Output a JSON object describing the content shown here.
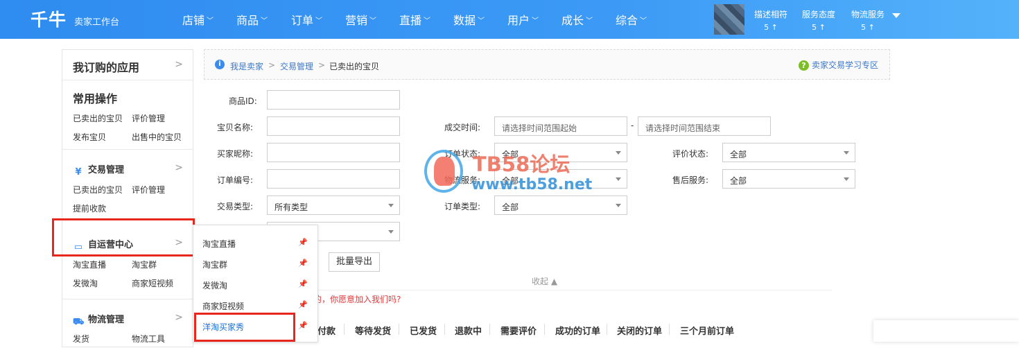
{
  "header": {
    "logo": "千牛",
    "logo_sub": "卖家工作台",
    "nav": [
      "店铺",
      "商品",
      "订单",
      "营销",
      "直播",
      "数据",
      "用户",
      "成长",
      "综合"
    ],
    "scores": [
      {
        "label": "描述相符",
        "value": "5 ↑"
      },
      {
        "label": "服务态度",
        "value": "5 ↑"
      },
      {
        "label": "物流服务",
        "value": "5 ↑"
      }
    ]
  },
  "sidebar": {
    "subscribed": "我订购的应用",
    "common": {
      "title": "常用操作",
      "links": [
        "已卖出的宝贝",
        "评价管理",
        "发布宝贝",
        "出售中的宝贝"
      ]
    },
    "trade": {
      "title": "交易管理",
      "links": [
        "已卖出的宝贝",
        "评价管理",
        "提前收款"
      ]
    },
    "self_ops": {
      "title": "自运营中心",
      "links": [
        "淘宝直播",
        "淘宝群",
        "发微淘",
        "商家短视频"
      ]
    },
    "logistics": {
      "title": "物流管理",
      "links": [
        "发货",
        "物流工具"
      ]
    }
  },
  "flyout": {
    "items": [
      "淘宝直播",
      "淘宝群",
      "发微淘",
      "商家短视频",
      "洋淘买家秀"
    ]
  },
  "breadcrumb": {
    "items": [
      "我是卖家",
      "交易管理",
      "已卖出的宝贝"
    ],
    "separator": ">",
    "help": "卖家交易学习专区"
  },
  "form": {
    "product_id_label": "商品ID:",
    "item_name_label": "宝贝名称:",
    "buyer_label": "买家昵称:",
    "order_no_label": "订单编号:",
    "trade_type_label": "交易类型:",
    "trade_type_value": "所有类型",
    "deal_time_label": "成交时间:",
    "deal_time_start": "请选择时间范围起始",
    "deal_time_end": "请选择时间范围结束",
    "deal_time_dash": "-",
    "order_status_label": "订单状态:",
    "order_status_value": "全部",
    "logistics_label": "物流服务:",
    "logistics_value": "全部",
    "order_type_label": "订单类型:",
    "order_type_value": "全部",
    "review_label": "评价状态:",
    "review_value": "全部",
    "after_sale_label": "售后服务:",
    "after_sale_value": "全部",
    "export_button": "批量导出",
    "collapse": "收起 ▲"
  },
  "notice": {
    "line1": "的，你愿意加入我们吗?"
  },
  "tabs": [
    "付款",
    "等待发货",
    "已发货",
    "退款中",
    "需要评价",
    "成功的订单",
    "关闭的订单",
    "三个月前订单"
  ],
  "watermark": {
    "line1": "TB58论坛",
    "line2": "www.tb58.net"
  }
}
